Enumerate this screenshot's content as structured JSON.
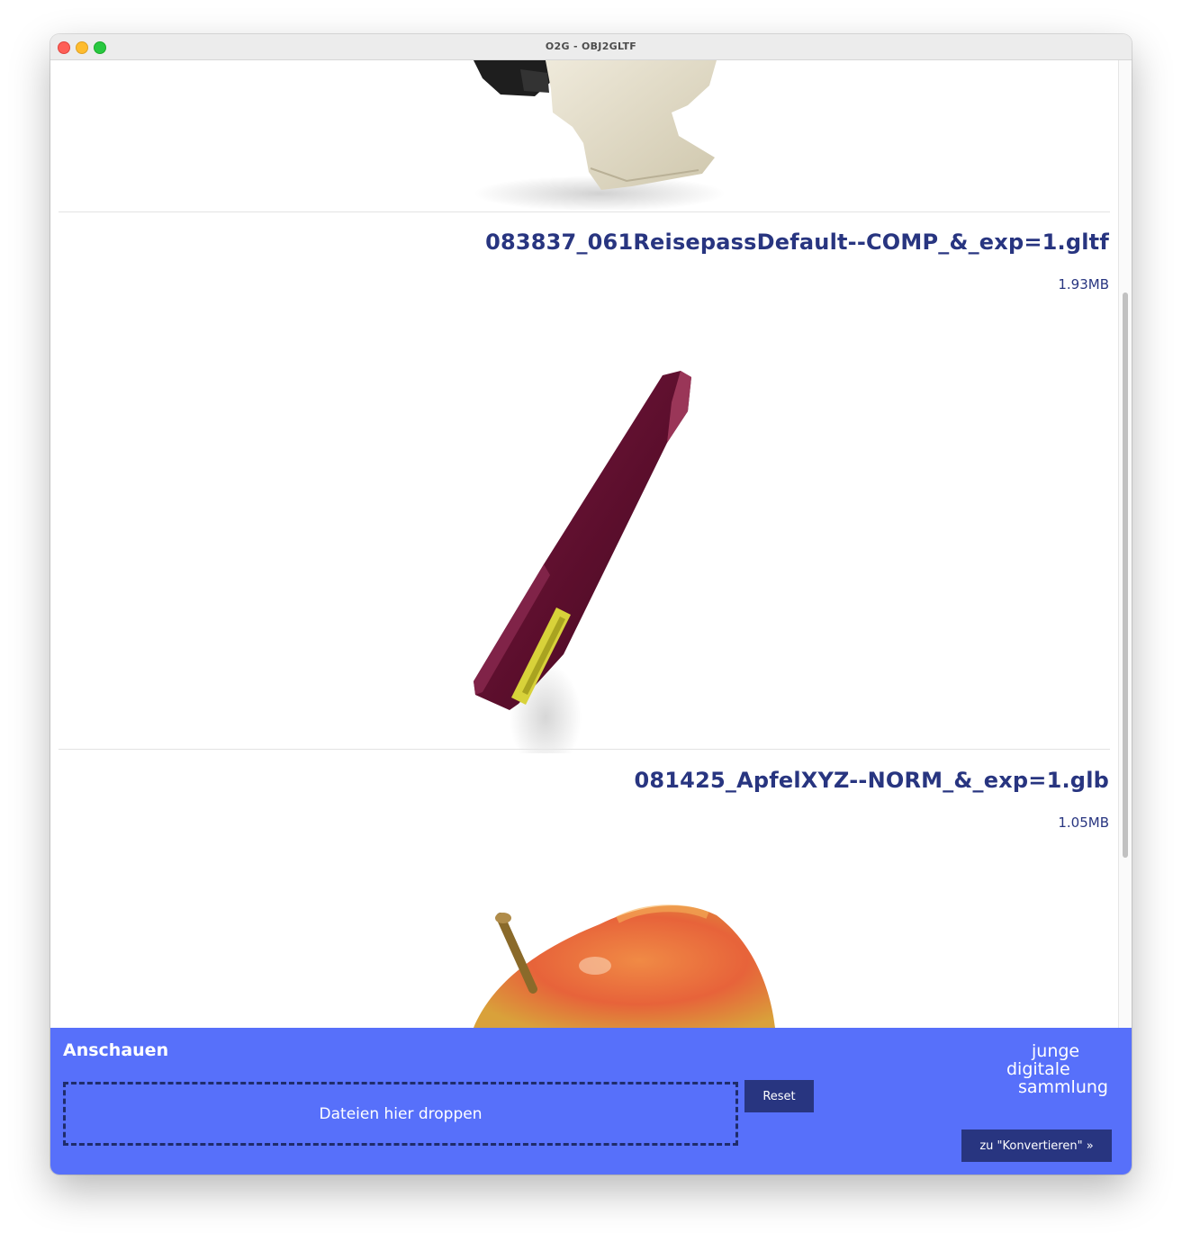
{
  "window": {
    "title": "O2G - OBJ2GLTF"
  },
  "files": [
    {
      "name": "083837_061ReisepassDefault--COMP_&_exp=1.gltf",
      "size": "1.93MB",
      "preview_icon": "passport-model"
    },
    {
      "name": "081425_ApfelXYZ--NORM_&_exp=1.glb",
      "size": "1.05MB",
      "preview_icon": "apple-model"
    }
  ],
  "panel": {
    "title": "Anschauen",
    "dropzone_label": "Dateien hier droppen",
    "reset_label": "Reset",
    "convert_label": "zu \"Konvertieren\" »",
    "logo_lines": [
      "junge",
      "digitale",
      "sammlung"
    ]
  },
  "colors": {
    "accent": "#5770fa",
    "dark_blue": "#283580",
    "file_text": "#283580"
  }
}
